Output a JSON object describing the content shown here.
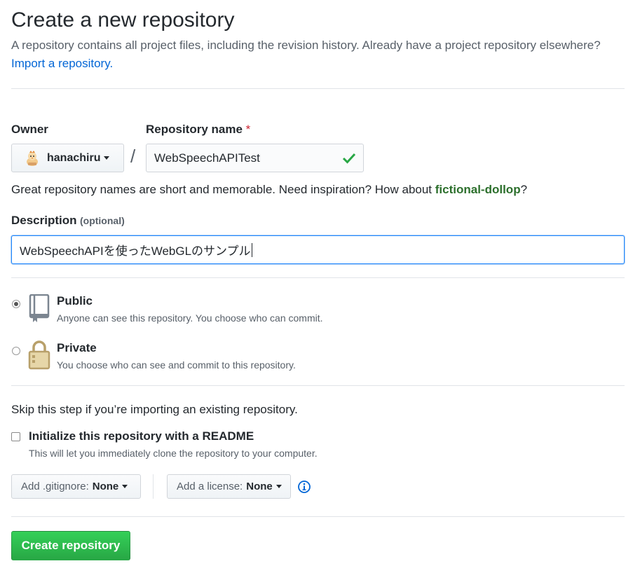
{
  "header": {
    "title": "Create a new repository",
    "description": "A repository contains all project files, including the revision history. Already have a project repository elsewhere?",
    "import_link": "Import a repository."
  },
  "owner": {
    "label": "Owner",
    "value": "hanachiru",
    "avatar_icon": "chick-avatar-icon"
  },
  "separator": "/",
  "repo_name": {
    "label": "Repository name",
    "required_mark": "*",
    "value": "WebSpeechAPITest",
    "valid_icon": "check-icon"
  },
  "suggestion": {
    "text_before": "Great repository names are short and memorable. Need inspiration? How about ",
    "name": "fictional-dollop",
    "text_after": "?"
  },
  "description": {
    "label": "Description",
    "optional": "(optional)",
    "value": "WebSpeechAPIを使ったWebGLのサンプル"
  },
  "visibility": {
    "public": {
      "title": "Public",
      "note": "Anyone can see this repository. You choose who can commit.",
      "checked": true,
      "icon": "repo-book-icon"
    },
    "private": {
      "title": "Private",
      "note": "You choose who can see and commit to this repository.",
      "checked": false,
      "icon": "lock-icon"
    }
  },
  "init": {
    "skip_text": "Skip this step if you’re importing an existing repository.",
    "readme_label": "Initialize this repository with a README",
    "readme_note": "This will let you immediately clone the repository to your computer.",
    "readme_checked": false
  },
  "gitignore": {
    "prefix": "Add .gitignore:",
    "value": "None"
  },
  "license": {
    "prefix": "Add a license:",
    "value": "None",
    "info_icon": "info-icon"
  },
  "submit": {
    "label": "Create repository"
  },
  "colors": {
    "link": "#0366d6",
    "primary": "#2ea44f",
    "suggestion": "#2c6f2c",
    "check": "#28a745"
  }
}
